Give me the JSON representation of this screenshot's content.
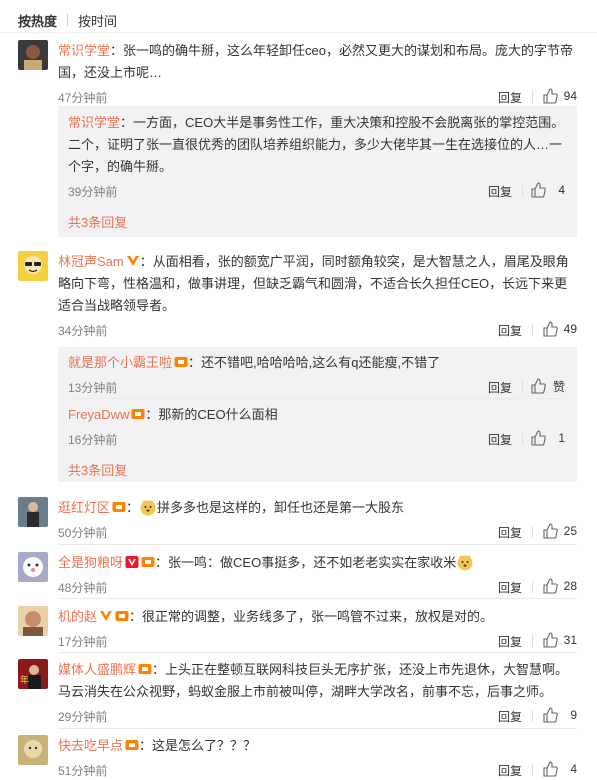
{
  "tabs": {
    "hot": "按热度",
    "time": "按时间"
  },
  "comments": [
    {
      "user": "常识学堂",
      "text": "张一鸣的确牛掰，这么年轻卸任ceo，必然又更大的谋划和布局。庞大的字节帝国，还没上市呢…",
      "time": "47分钟前",
      "reply": "回复",
      "likes": "94",
      "subs": [
        {
          "user": "常识学堂",
          "text": "一方面，CEO大半是事务性工作，重大决策和控股不会脱离张的掌控范围。二个，证明了张一直很优秀的团队培养组织能力，多少大佬毕其一生在选接位的人…一个字，的确牛掰。",
          "time": "39分钟前",
          "reply": "回复",
          "likes": "4"
        }
      ],
      "more": "共3条回复"
    },
    {
      "user": "林冠声Sam",
      "text": "从面相看，张的额宽广平润，同时额角较突，是大智慧之人，眉尾及眼角略向下弯，性格温和，做事讲理，但缺乏霸气和圆滑，不适合长久担任CEO，长远下来更适合当战略领导者。",
      "time": "34分钟前",
      "reply": "回复",
      "likes": "49",
      "subs": [
        {
          "user": "就是那个小霸王啦",
          "text": "还不错吧,哈哈哈哈,这么有q还能瘦,不错了",
          "time": "13分钟前",
          "reply": "回复",
          "likes": "赞"
        },
        {
          "user": "FreyaDww",
          "text": "那新的CEO什么面相",
          "time": "16分钟前",
          "reply": "回复",
          "likes": "1"
        }
      ],
      "more": "共3条回复"
    },
    {
      "user": "逛红灯区",
      "text": "拼多多也是这样的，卸任也还是第一大股东",
      "time": "50分钟前",
      "reply": "回复",
      "likes": "25"
    },
    {
      "user": "全是狗粮呀",
      "text": "张一鸣：做CEO事挺多，还不如老老实实在家收米",
      "time": "48分钟前",
      "reply": "回复",
      "likes": "28"
    },
    {
      "user": "机的赵",
      "text": "很正常的调整，业务线多了，张一鸣管不过来，放权是对的。",
      "time": "17分钟前",
      "reply": "回复",
      "likes": "31"
    },
    {
      "user": "媒体人盛鹏辉",
      "text": "上头正在整顿互联网科技巨头无序扩张，还没上市先退休，大智慧啊。马云消失在公众视野，蚂蚁金服上市前被叫停，湖畔大学改名，前事不忘，后事之师。",
      "time": "29分钟前",
      "reply": "回复",
      "likes": "9"
    },
    {
      "user": "快去吃早点",
      "text": "这是怎么了？？？",
      "time": "51分钟前",
      "reply": "回复",
      "likes": "4"
    }
  ],
  "colors": {
    "username": "#eb7350",
    "badge_orange": "#ff8200",
    "badge_red": "#e6162d",
    "sub_bg": "#f2f2f5"
  }
}
